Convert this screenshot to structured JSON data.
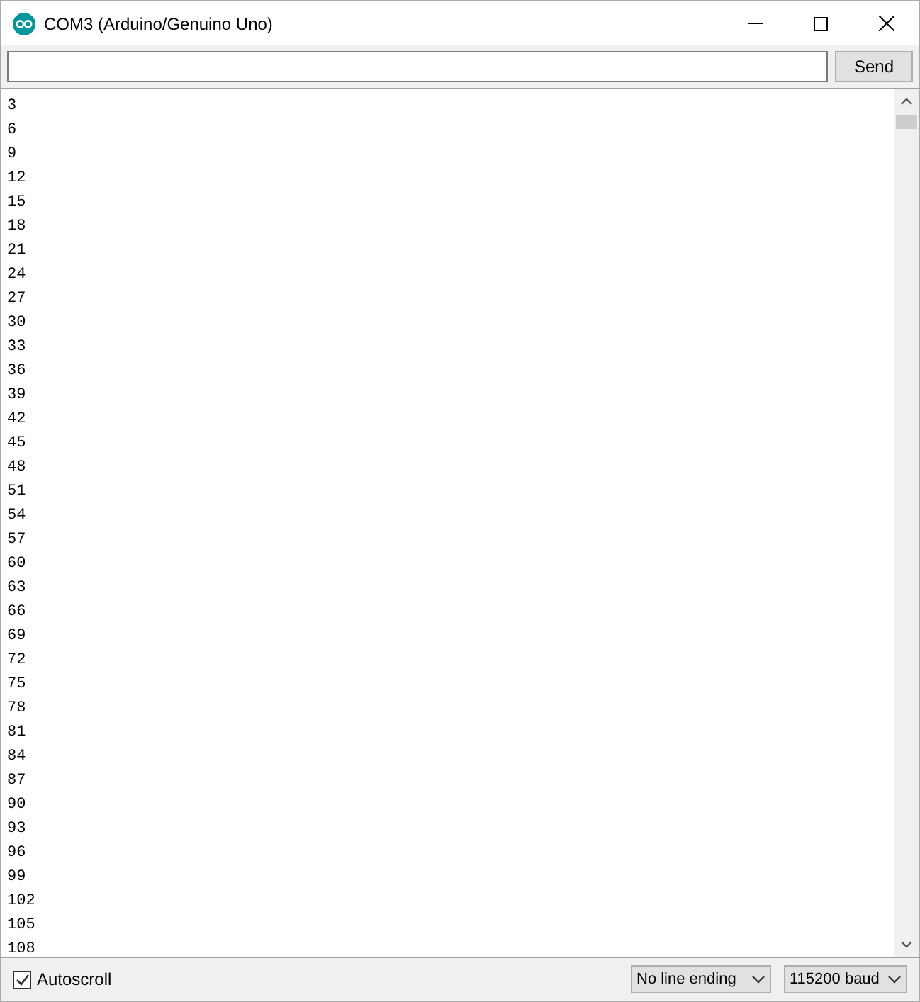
{
  "window": {
    "title": "COM3 (Arduino/Genuino Uno)"
  },
  "send_button": "Send",
  "output_lines": [
    "3",
    "6",
    "9",
    "12",
    "15",
    "18",
    "21",
    "24",
    "27",
    "30",
    "33",
    "36",
    "39",
    "42",
    "45",
    "48",
    "51",
    "54",
    "57",
    "60",
    "63",
    "66",
    "69",
    "72",
    "75",
    "78",
    "81",
    "84",
    "87",
    "90",
    "93",
    "96",
    "99",
    "102",
    "105",
    "108"
  ],
  "autoscroll": {
    "label": "Autoscroll",
    "checked": true
  },
  "line_ending": {
    "value": "No line ending"
  },
  "baud": {
    "value": "115200 baud"
  }
}
